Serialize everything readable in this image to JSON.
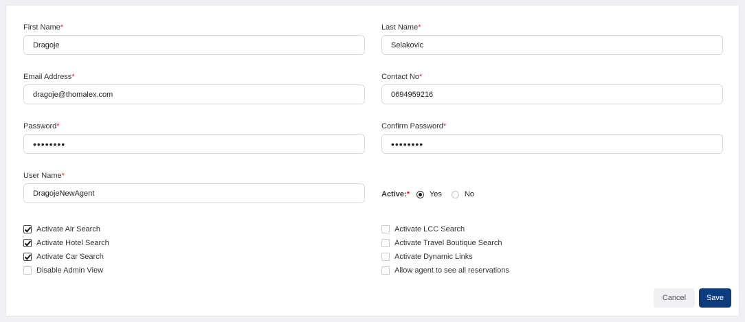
{
  "form": {
    "required_mark": "*",
    "first_name": {
      "label": "First Name",
      "value": "Dragoje"
    },
    "last_name": {
      "label": "Last Name",
      "value": "Selakovic"
    },
    "email": {
      "label": "Email Address",
      "value": "dragoje@thomalex.com"
    },
    "contact": {
      "label": "Contact No",
      "value": "0694959216"
    },
    "password": {
      "label": "Password",
      "value": "••••••••"
    },
    "confirm_password": {
      "label": "Confirm Password",
      "value": "••••••••"
    },
    "username": {
      "label": "User Name",
      "value": "DragojeNewAgent"
    },
    "active": {
      "label": "Active:",
      "yes": "Yes",
      "no": "No",
      "selected": "Yes"
    }
  },
  "checkboxes_left": [
    {
      "label": "Activate Air Search",
      "checked": true
    },
    {
      "label": "Activate Hotel Search",
      "checked": true
    },
    {
      "label": "Activate Car Search",
      "checked": true
    },
    {
      "label": "Disable Admin View",
      "checked": false
    }
  ],
  "checkboxes_right": [
    {
      "label": "Activate LCC Search",
      "checked": false
    },
    {
      "label": "Activate Travel Boutique Search",
      "checked": false
    },
    {
      "label": "Activate Dynamic Links",
      "checked": false
    },
    {
      "label": "Allow agent to see all reservations",
      "checked": false
    }
  ],
  "buttons": {
    "cancel": "Cancel",
    "save": "Save"
  },
  "colors": {
    "primary": "#0d3c7e",
    "required": "#d9232e"
  }
}
